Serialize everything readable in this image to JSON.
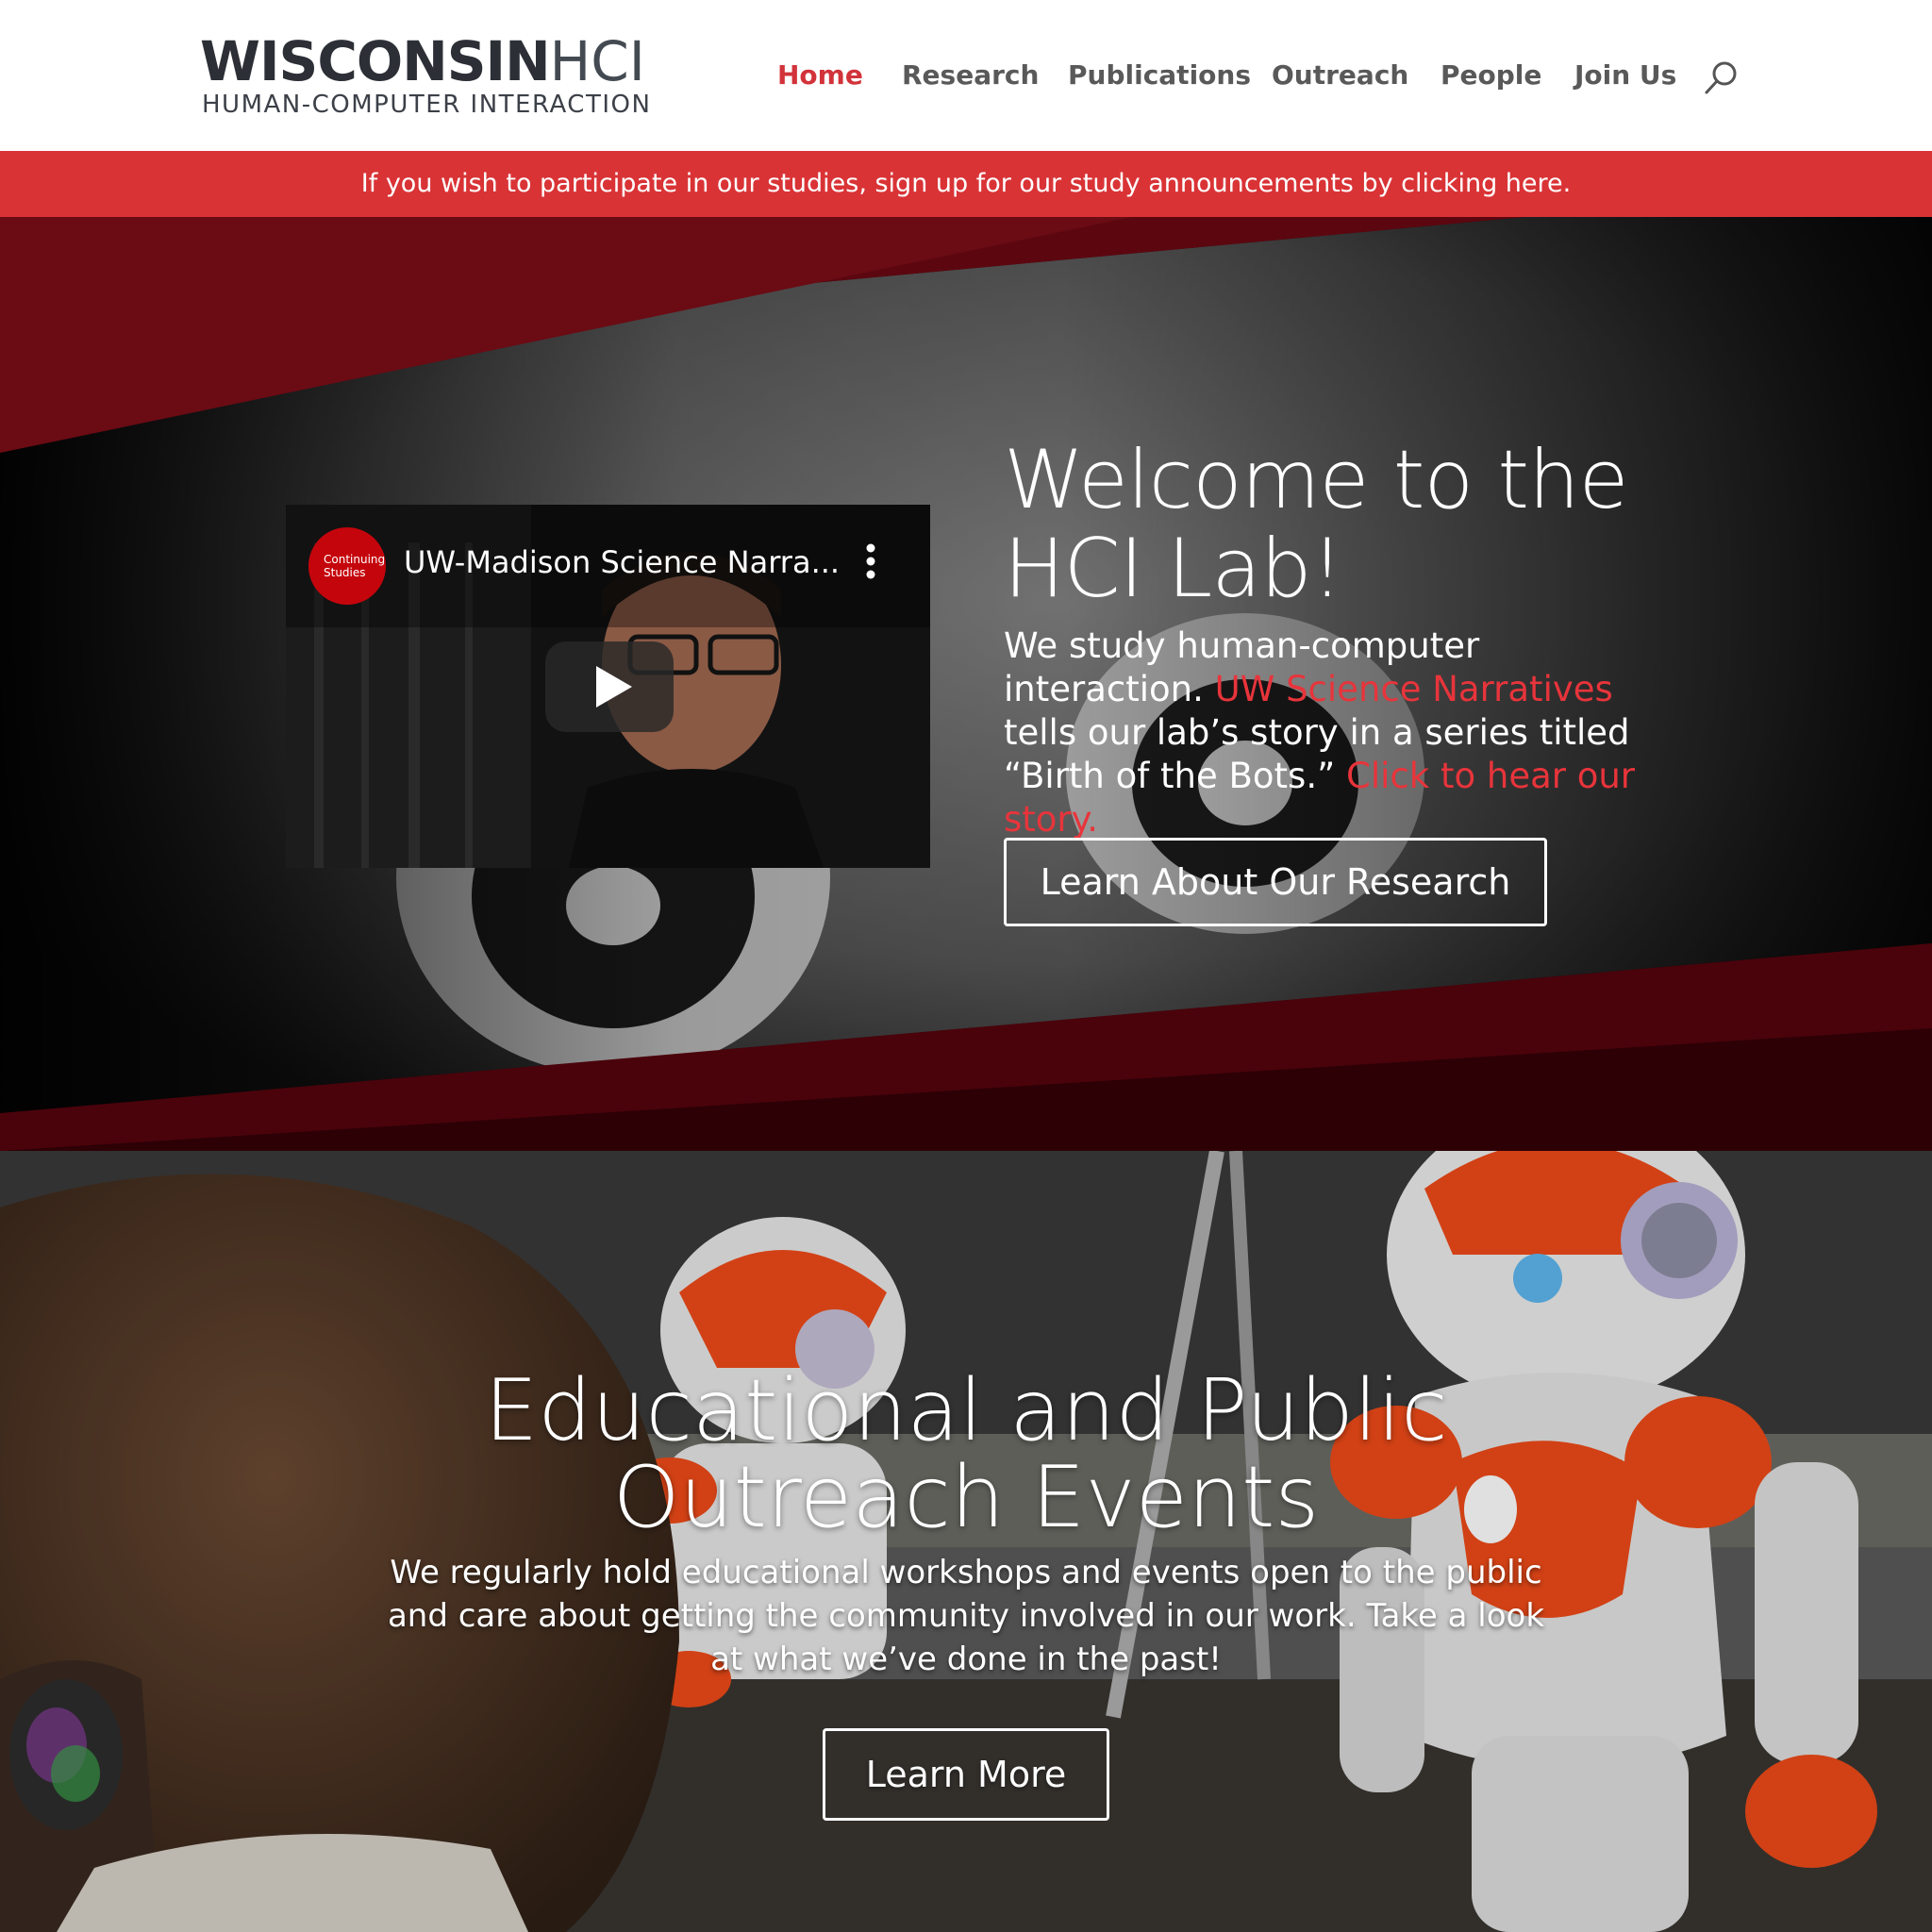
{
  "header": {
    "logo": {
      "bold": "WISCONSIN",
      "light": "HCI",
      "subtitle": "HUMAN-COMPUTER INTERACTION"
    },
    "nav": [
      {
        "label": "Home",
        "active": true
      },
      {
        "label": "Research",
        "active": false
      },
      {
        "label": "Publications",
        "active": false
      },
      {
        "label": "Outreach",
        "active": false
      },
      {
        "label": "People",
        "active": false
      },
      {
        "label": "Join Us",
        "active": false
      }
    ],
    "search_icon": "search-icon"
  },
  "announcement": {
    "text": "If you wish to participate in our studies, sign up for our study announcements by clicking here."
  },
  "hero": {
    "video": {
      "title": "UW-Madison Science Narra...",
      "channel_logo_text": "Continuing Studies",
      "icons": [
        "more-vert-icon",
        "play-icon"
      ]
    },
    "title": "Welcome to the HCI Lab!",
    "text_1": "We study human-computer interaction. ",
    "link_1": "UW Science Narratives",
    "text_2": " tells our lab’s story in a series titled “Birth of the Bots.” ",
    "link_2": "Click to hear our story.",
    "button": "Learn About Our Research"
  },
  "outreach": {
    "title": "Educational and Public Outreach Events",
    "text": "We regularly hold educational workshops and events open to the public and care about getting the community involved in our work. Take a look at what we’ve done in the past!",
    "button": "Learn More"
  },
  "colors": {
    "accent": "#d2333a",
    "announce_bg": "#d93336",
    "nav_text": "#595959",
    "link_red": "#e8343b",
    "hero_dark_red": "#6b0b14"
  }
}
